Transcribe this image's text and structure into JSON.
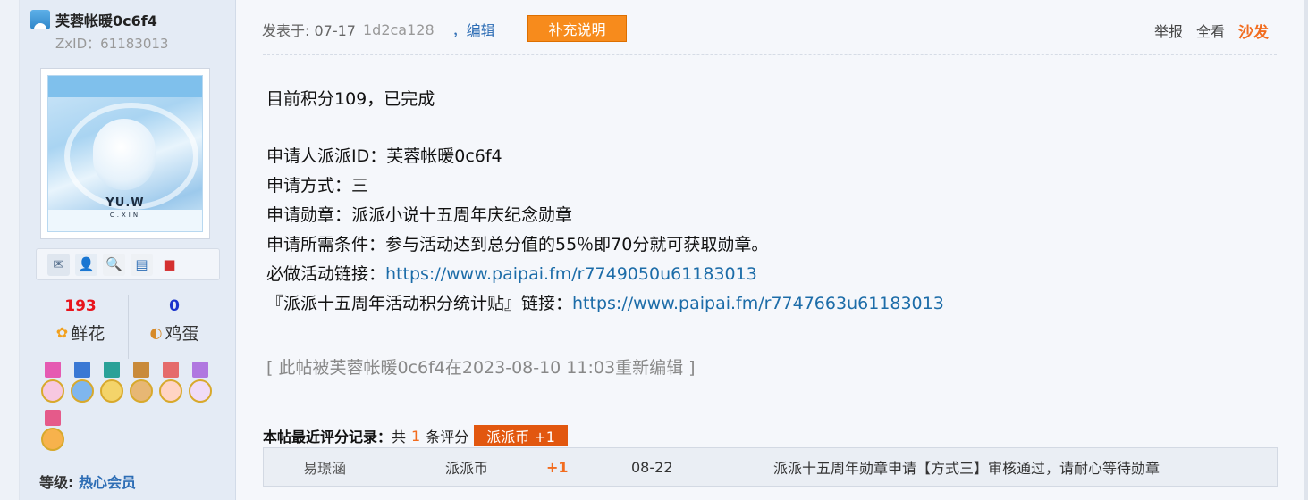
{
  "user": {
    "name": "芙蓉帐暖0c6f4",
    "zxid": "ZxID：61183013",
    "avatar_text": "YU.W",
    "avatar_sub": "C.XIN",
    "level_label": "等级:",
    "level_value": "热心会员"
  },
  "stats": {
    "flowers_count": "193",
    "flowers_label": "鲜花",
    "eggs_count": "0",
    "eggs_label": "鸡蛋"
  },
  "post": {
    "posted_label": "发表于: 07-17",
    "hash": "1d2ca128",
    "edit_label": "，编辑",
    "supplement_button": "补充说明",
    "actions": {
      "report": "举报",
      "view_all": "全看",
      "floor": "沙发"
    },
    "lines": {
      "l1": "目前积分109，已完成",
      "l2": "申请人派派ID：芙蓉帐暖0c6f4",
      "l3": "申请方式：三",
      "l4": "申请勋章：派派小说十五周年庆纪念勋章",
      "l5": "申请所需条件：参与活动达到总分值的55％即70分就可获取勋章。",
      "l6_label": "必做活动链接：",
      "l6_link": "https://www.paipai.fm/r7749050u61183013",
      "l7_label": "『派派十五周年活动积分统计贴』链接：",
      "l7_link": "https://www.paipai.fm/r7747663u61183013"
    },
    "edit_note": "[ 此帖被芙蓉帐暖0c6f4在2023-08-10 11:03重新编辑 ]"
  },
  "rating": {
    "title": "本帖最近评分记录：",
    "total_prefix": "共",
    "total_count": "1",
    "total_suffix": "条评分",
    "badge": "派派币 +1",
    "row": {
      "user": "易璟涵",
      "currency": "派派币",
      "amount": "+1",
      "date": "08-22",
      "reason": "派派十五周年勋章申请【方式三】审核通过，请耐心等待勋章"
    }
  },
  "colors": {
    "accent_orange": "#f78b1c",
    "link_blue": "#1c6ca8",
    "badge_red": "#e2570f",
    "flower_red": "#e8141c",
    "egg_blue": "#1a33cc"
  }
}
